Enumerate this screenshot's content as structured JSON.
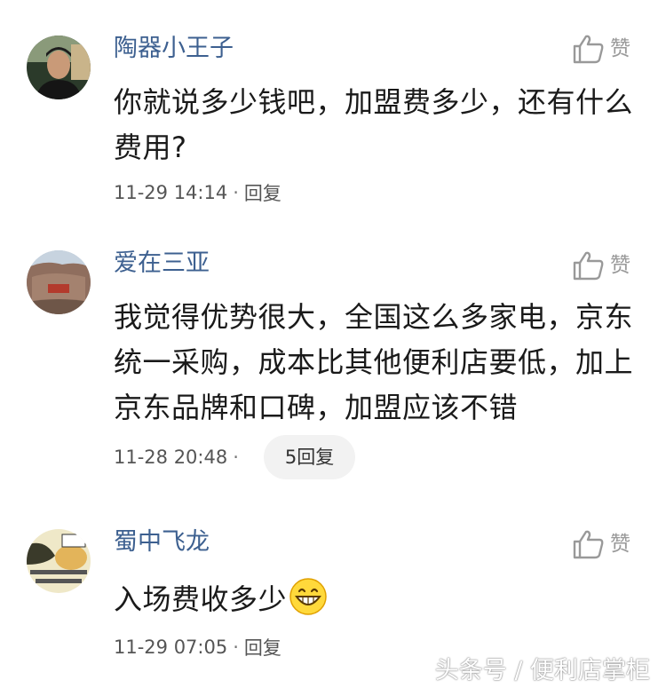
{
  "comments": [
    {
      "username": "陶器小王子",
      "avatar_icon": "user-avatar-man",
      "text": "你就说多少钱吧，加盟费多少，还有什么费用?",
      "timestamp": "11-29 14:14",
      "separator": "·",
      "reply_label": "回复",
      "like_label": "赞"
    },
    {
      "username": "爱在三亚",
      "avatar_icon": "user-avatar-rock",
      "text": "我觉得优势很大，全国这么多家电，京东统一采购，成本比其他便利店要低，加上京东品牌和口碑，加盟应该不错",
      "timestamp": "11-28 20:48",
      "separator": "·",
      "reply_label": "5回复",
      "like_label": "赞"
    },
    {
      "username": "蜀中飞龙",
      "avatar_icon": "user-avatar-cartoon",
      "text": "入场费收多少",
      "emoji_icon": "grinning-face-icon",
      "timestamp": "11-29 07:05",
      "separator": "·",
      "reply_label": "回复",
      "like_label": "赞"
    }
  ],
  "watermark": "头条号 / 便利店掌柜",
  "colors": {
    "username": "#3d6090",
    "content": "#1a1a1a",
    "meta": "#555555",
    "icon": "#999999",
    "pill_bg": "#f2f2f2"
  }
}
